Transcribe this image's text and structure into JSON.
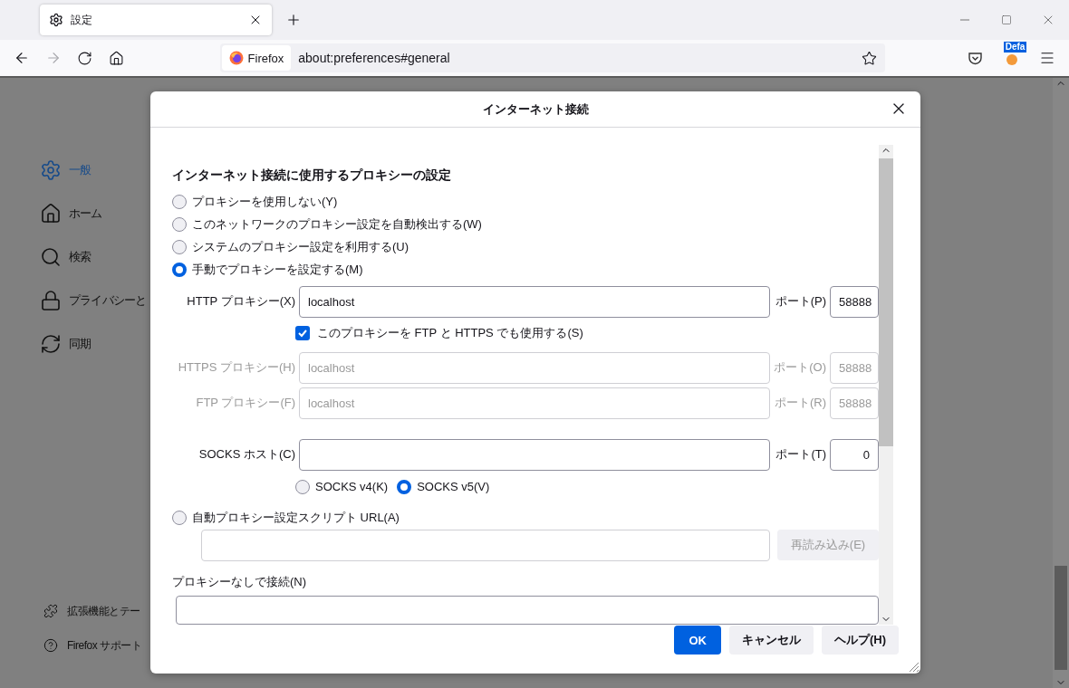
{
  "browser": {
    "tab": {
      "title": "設定",
      "selected": true
    },
    "identity": "Firefox",
    "url": "about:preferences#general",
    "extension_badge": "Defa"
  },
  "sidebar": {
    "items": [
      {
        "label": "一般",
        "selected": true
      },
      {
        "label": "ホーム",
        "selected": false
      },
      {
        "label": "検索",
        "selected": false
      },
      {
        "label": "プライバシーと",
        "selected": false
      },
      {
        "label": "同期",
        "selected": false
      }
    ],
    "footer": [
      {
        "label": "拡張機能とテー"
      },
      {
        "label": "Firefox サポート"
      }
    ]
  },
  "dialog": {
    "title": "インターネット接続",
    "heading": "インターネット接続に使用するプロキシーの設定",
    "modes": [
      {
        "label": "プロキシーを使用しない(Y)",
        "kind": "plain",
        "selected": false
      },
      {
        "label": "このネットワークのプロキシー設定を自動検出する(W)",
        "kind": "plain",
        "selected": false
      },
      {
        "label": "システムのプロキシー設定を利用する(U)",
        "kind": "plain",
        "selected": false
      },
      {
        "label": "手動でプロキシーを設定する(M)",
        "kind": "manual",
        "selected": true
      },
      {
        "label": "自動プロキシー設定スクリプト URL(A)",
        "kind": "auto",
        "selected": false
      }
    ],
    "manual": [
      {
        "kind": "proxy",
        "label": "HTTP プロキシー(X)",
        "value": "localhost",
        "port_label": "ポート(P)",
        "port": "58888",
        "disabled": false
      },
      {
        "kind": "checkbox",
        "label": "このプロキシーを FTP と HTTPS でも使用する(S)",
        "checked": true
      },
      {
        "kind": "proxy",
        "label": "HTTPS プロキシー(H)",
        "value": "localhost",
        "port_label": "ポート(O)",
        "port": "58888",
        "disabled": true
      },
      {
        "kind": "proxy",
        "label": "FTP プロキシー(F)",
        "value": "localhost",
        "port_label": "ポート(R)",
        "port": "58888",
        "disabled": true
      },
      {
        "kind": "socks",
        "label": "SOCKS ホスト(C)",
        "port_label": "ポート(T)",
        "port": "0",
        "disabled": false,
        "versions": [
          {
            "label": "SOCKS v4(K)",
            "selected": false
          },
          {
            "label": "SOCKS v5(V)",
            "selected": true
          }
        ]
      }
    ],
    "auto": {
      "reload": {
        "label": "再読み込み(E)",
        "disabled": true
      }
    },
    "no_proxy_label": "プロキシーなしで接続(N)",
    "buttons": [
      {
        "label": "OK",
        "kind": "primary"
      },
      {
        "label": "キャンセル",
        "kind": "normal"
      },
      {
        "label": "ヘルプ(H)",
        "kind": "normal"
      }
    ]
  }
}
